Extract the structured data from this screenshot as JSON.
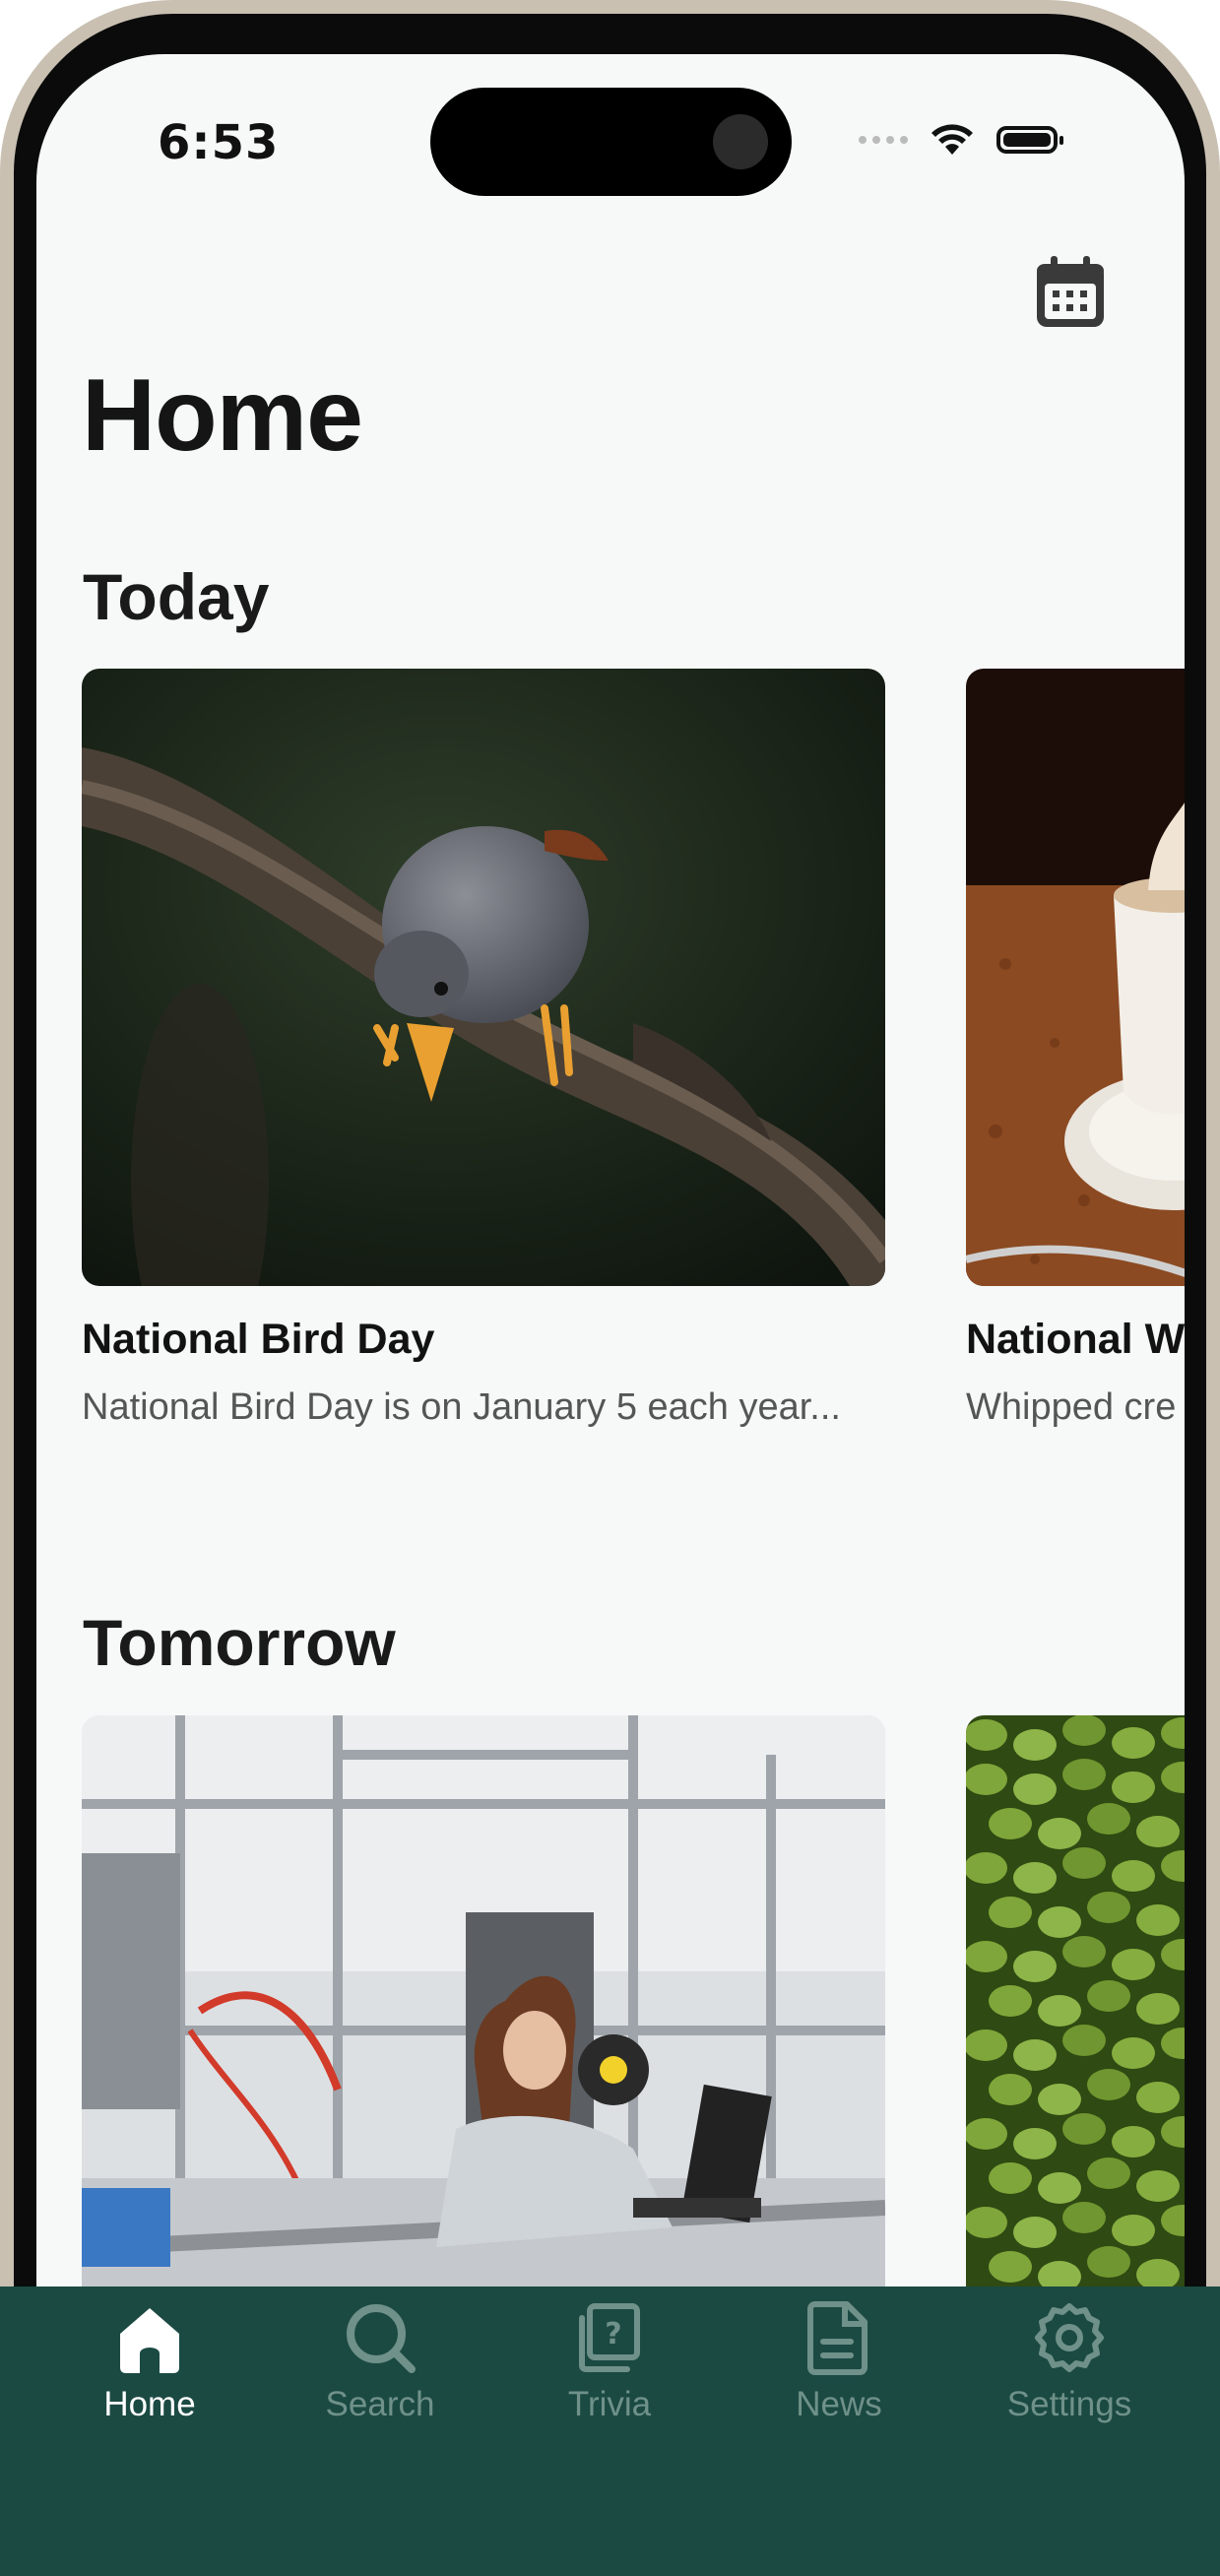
{
  "status_bar": {
    "time": "6:53"
  },
  "header": {
    "title": "Home",
    "calendar_icon": "calendar-icon"
  },
  "sections": [
    {
      "title": "Today",
      "cards": [
        {
          "title": "National Bird Day",
          "description": "National Bird Day is on January 5 each year...",
          "image": "bird on branch photo"
        },
        {
          "title": "National W",
          "description": "Whipped cre",
          "image": "coffee with whipped cream photo"
        }
      ]
    },
    {
      "title": "Tomorrow",
      "cards": [
        {
          "title": "",
          "description": "",
          "image": "woman working in lab photo"
        },
        {
          "title": "",
          "description": "",
          "image": "green beans photo"
        }
      ]
    }
  ],
  "tabbar": {
    "items": [
      {
        "label": "Home",
        "icon": "home-icon",
        "active": true
      },
      {
        "label": "Search",
        "icon": "search-icon",
        "active": false
      },
      {
        "label": "Trivia",
        "icon": "trivia-icon",
        "active": false
      },
      {
        "label": "News",
        "icon": "news-icon",
        "active": false
      },
      {
        "label": "Settings",
        "icon": "gear-icon",
        "active": false
      }
    ]
  },
  "colors": {
    "accent": "#1b4a43",
    "background": "#f7f9f9",
    "active_tab": "#ffffff",
    "inactive_tab": "#6f9189"
  }
}
